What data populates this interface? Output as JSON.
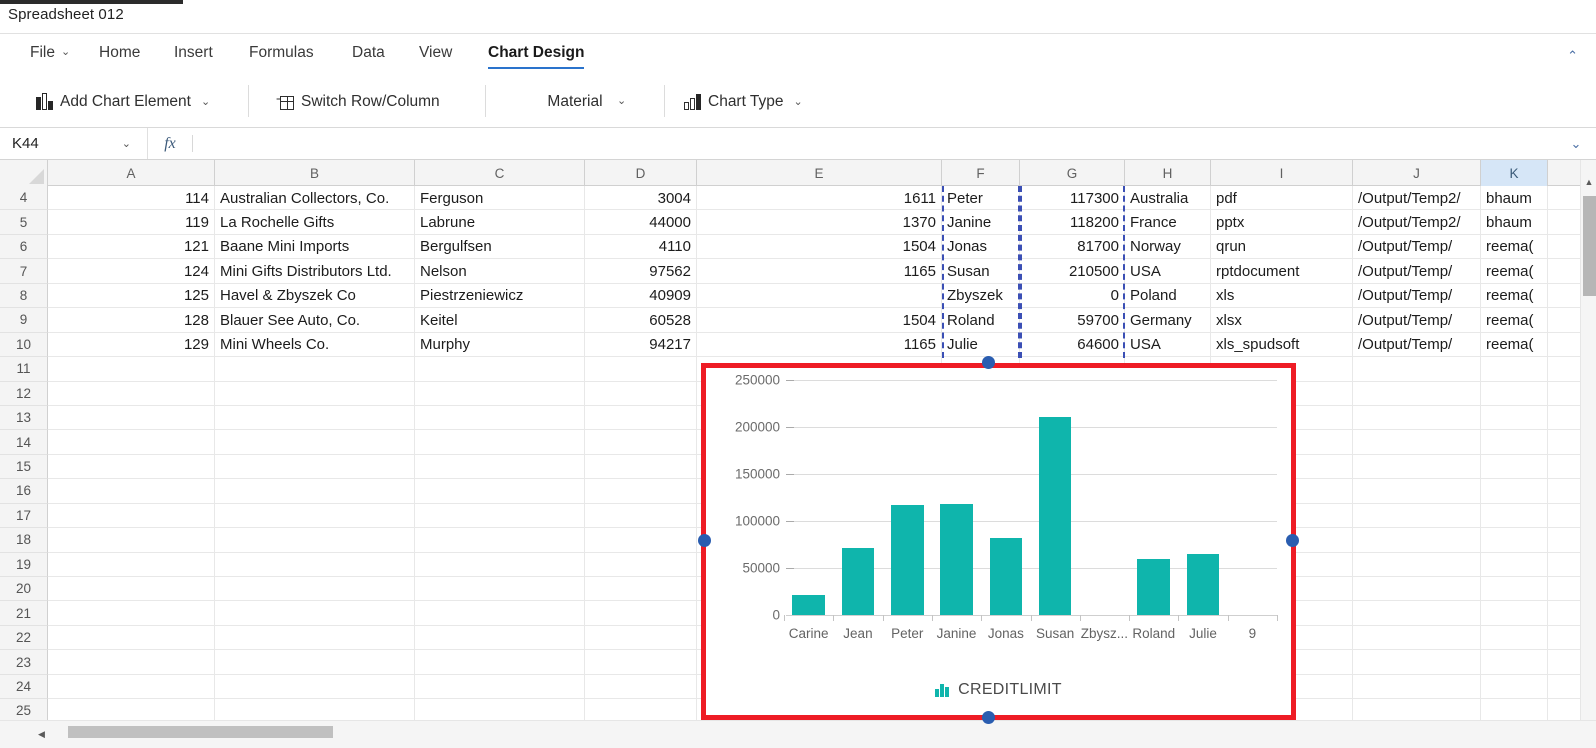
{
  "window": {
    "doc_title": "Spreadsheet 012"
  },
  "ribbon": {
    "tabs": [
      {
        "label": "File",
        "chevron": "⌄",
        "active": false
      },
      {
        "label": "Home",
        "active": false
      },
      {
        "label": "Insert",
        "active": false
      },
      {
        "label": "Formulas",
        "active": false
      },
      {
        "label": "Data",
        "active": false
      },
      {
        "label": "View",
        "active": false
      },
      {
        "label": "Chart Design",
        "active": true
      }
    ],
    "collapse_icon": "⌃",
    "groups": [
      {
        "label": "Add Chart Element",
        "icon": "chart-element-icon",
        "chevron": "⌄"
      },
      {
        "label": "Switch Row/Column",
        "icon": "switch-row-column-icon",
        "chevron": ""
      },
      {
        "label": "Material",
        "icon": "",
        "chevron": "⌄"
      },
      {
        "label": "Chart Type",
        "icon": "chart-type-icon",
        "chevron": "⌄"
      }
    ]
  },
  "formula_bar": {
    "name_box": "K44",
    "name_box_chevron": "⌄",
    "fx_label": "fx",
    "formula_value": "",
    "expand_chevron": "⌄"
  },
  "grid": {
    "columns": [
      "A",
      "B",
      "C",
      "D",
      "E",
      "F",
      "G",
      "H",
      "I",
      "J",
      "K"
    ],
    "selected_column": "K",
    "row_numbers": [
      4,
      5,
      6,
      7,
      8,
      9,
      10,
      11,
      12,
      13,
      14,
      15,
      16,
      17,
      18,
      19,
      20,
      21,
      22,
      23,
      24,
      25
    ],
    "rows": [
      {
        "n": 4,
        "A": "114",
        "B": "Australian Collectors, Co.",
        "C": "Ferguson",
        "D": "3004",
        "E": "1611",
        "F": "Peter",
        "G": "117300",
        "H": "Australia",
        "I": "pdf",
        "J": "/Output/Temp2/",
        "K": "bhaum"
      },
      {
        "n": 5,
        "A": "119",
        "B": "La Rochelle Gifts",
        "C": "Labrune",
        "D": "44000",
        "E": "1370",
        "F": "Janine",
        "G": "118200",
        "H": "France",
        "I": "pptx",
        "J": "/Output/Temp2/",
        "K": "bhaum"
      },
      {
        "n": 6,
        "A": "121",
        "B": "Baane Mini Imports",
        "C": "Bergulfsen",
        "D": "4110",
        "E": "1504",
        "F": "Jonas",
        "G": "81700",
        "H": "Norway",
        "I": "qrun",
        "J": "/Output/Temp/",
        "K": "reema("
      },
      {
        "n": 7,
        "A": "124",
        "B": "Mini Gifts Distributors Ltd.",
        "C": "Nelson",
        "D": "97562",
        "E": "1165",
        "F": "Susan",
        "G": "210500",
        "H": "USA",
        "I": "rptdocument",
        "J": "/Output/Temp/",
        "K": "reema("
      },
      {
        "n": 8,
        "A": "125",
        "B": "Havel & Zbyszek Co",
        "C": "Piestrzeniewicz",
        "D": "40909",
        "E": "",
        "F": "Zbyszek",
        "G": "0",
        "H": "Poland",
        "I": "xls",
        "J": "/Output/Temp/",
        "K": "reema("
      },
      {
        "n": 9,
        "A": "128",
        "B": "Blauer See Auto, Co.",
        "C": "Keitel",
        "D": "60528",
        "E": "1504",
        "F": "Roland",
        "G": "59700",
        "H": "Germany",
        "I": "xlsx",
        "J": "/Output/Temp/",
        "K": "reema("
      },
      {
        "n": 10,
        "A": "129",
        "B": "Mini Wheels Co.",
        "C": "Murphy",
        "D": "94217",
        "E": "1165",
        "F": "Julie",
        "G": "64600",
        "H": "USA",
        "I": "xls_spudsoft",
        "J": "/Output/Temp/",
        "K": "reema("
      }
    ]
  },
  "chart_data": {
    "type": "bar",
    "title": "",
    "categories": [
      "Carine",
      "Jean",
      "Peter",
      "Janine",
      "Jonas",
      "Susan",
      "Zbysz...",
      "Roland",
      "Julie",
      "9"
    ],
    "values": [
      21000,
      71800,
      117300,
      118200,
      81700,
      210500,
      0,
      59700,
      64600,
      0
    ],
    "series": [
      {
        "name": "CREDITLIMIT",
        "values": [
          21000,
          71800,
          117300,
          118200,
          81700,
          210500,
          0,
          59700,
          64600,
          0
        ]
      }
    ],
    "xlabel": "",
    "ylabel": "",
    "ylim": [
      0,
      250000
    ],
    "yticks": [
      0,
      50000,
      100000,
      150000,
      200000,
      250000
    ],
    "ytick_labels": [
      "0",
      "50000",
      "100000",
      "150000",
      "200000",
      "250000"
    ],
    "legend": [
      "CREDITLIMIT"
    ],
    "legend_position": "bottom",
    "grid": true,
    "bar_color": "#0fb5ac",
    "selection_border_color": "#ee1c25",
    "handle_color": "#2a5db0"
  },
  "scrollbars": {
    "vertical_up_arrow": "▲",
    "horizontal_left_arrow": "◀"
  }
}
